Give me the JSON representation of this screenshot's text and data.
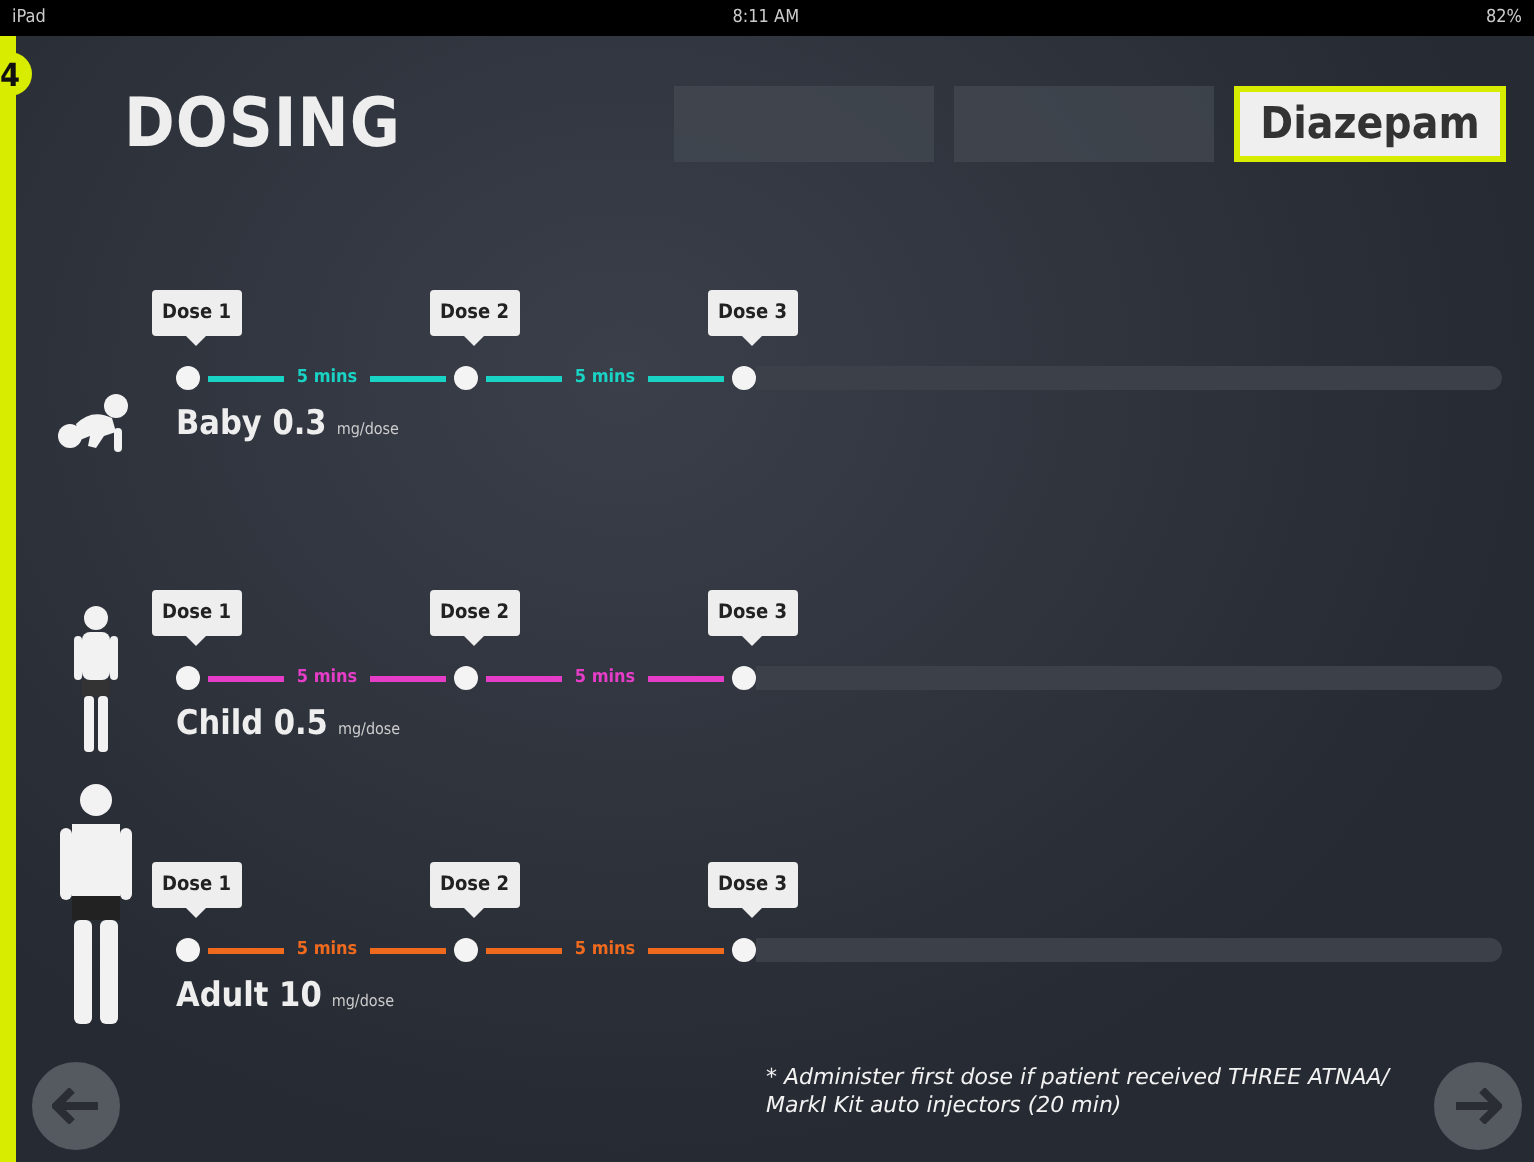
{
  "status_bar": {
    "device": "iPad",
    "time": "8:11 AM",
    "battery": "82%"
  },
  "step": "4",
  "title": "DOSING",
  "tabs": [
    {
      "selected": false
    },
    {
      "selected": false
    },
    {
      "label": "Diazepam",
      "selected": true
    }
  ],
  "patients": [
    {
      "kind": "baby",
      "label": "Baby 0.3",
      "unit": "mg/dose",
      "color": "#19d3c5",
      "doses": [
        "Dose 1",
        "Dose 2",
        "Dose 3"
      ],
      "intervals": [
        "5 mins",
        "5 mins"
      ]
    },
    {
      "kind": "child",
      "label": "Child 0.5",
      "unit": "mg/dose",
      "color": "#e63dc8",
      "doses": [
        "Dose 1",
        "Dose 2",
        "Dose 3"
      ],
      "intervals": [
        "5 mins",
        "5 mins"
      ]
    },
    {
      "kind": "adult",
      "label": "Adult 10",
      "unit": "mg/dose",
      "color": "#f06a1e",
      "doses": [
        "Dose 1",
        "Dose 2",
        "Dose 3"
      ],
      "intervals": [
        "5 mins",
        "5 mins"
      ]
    }
  ],
  "footnote": "* Administer first dose if patient received THREE ATNAA/ MarkI Kit auto injectors (20 min)"
}
